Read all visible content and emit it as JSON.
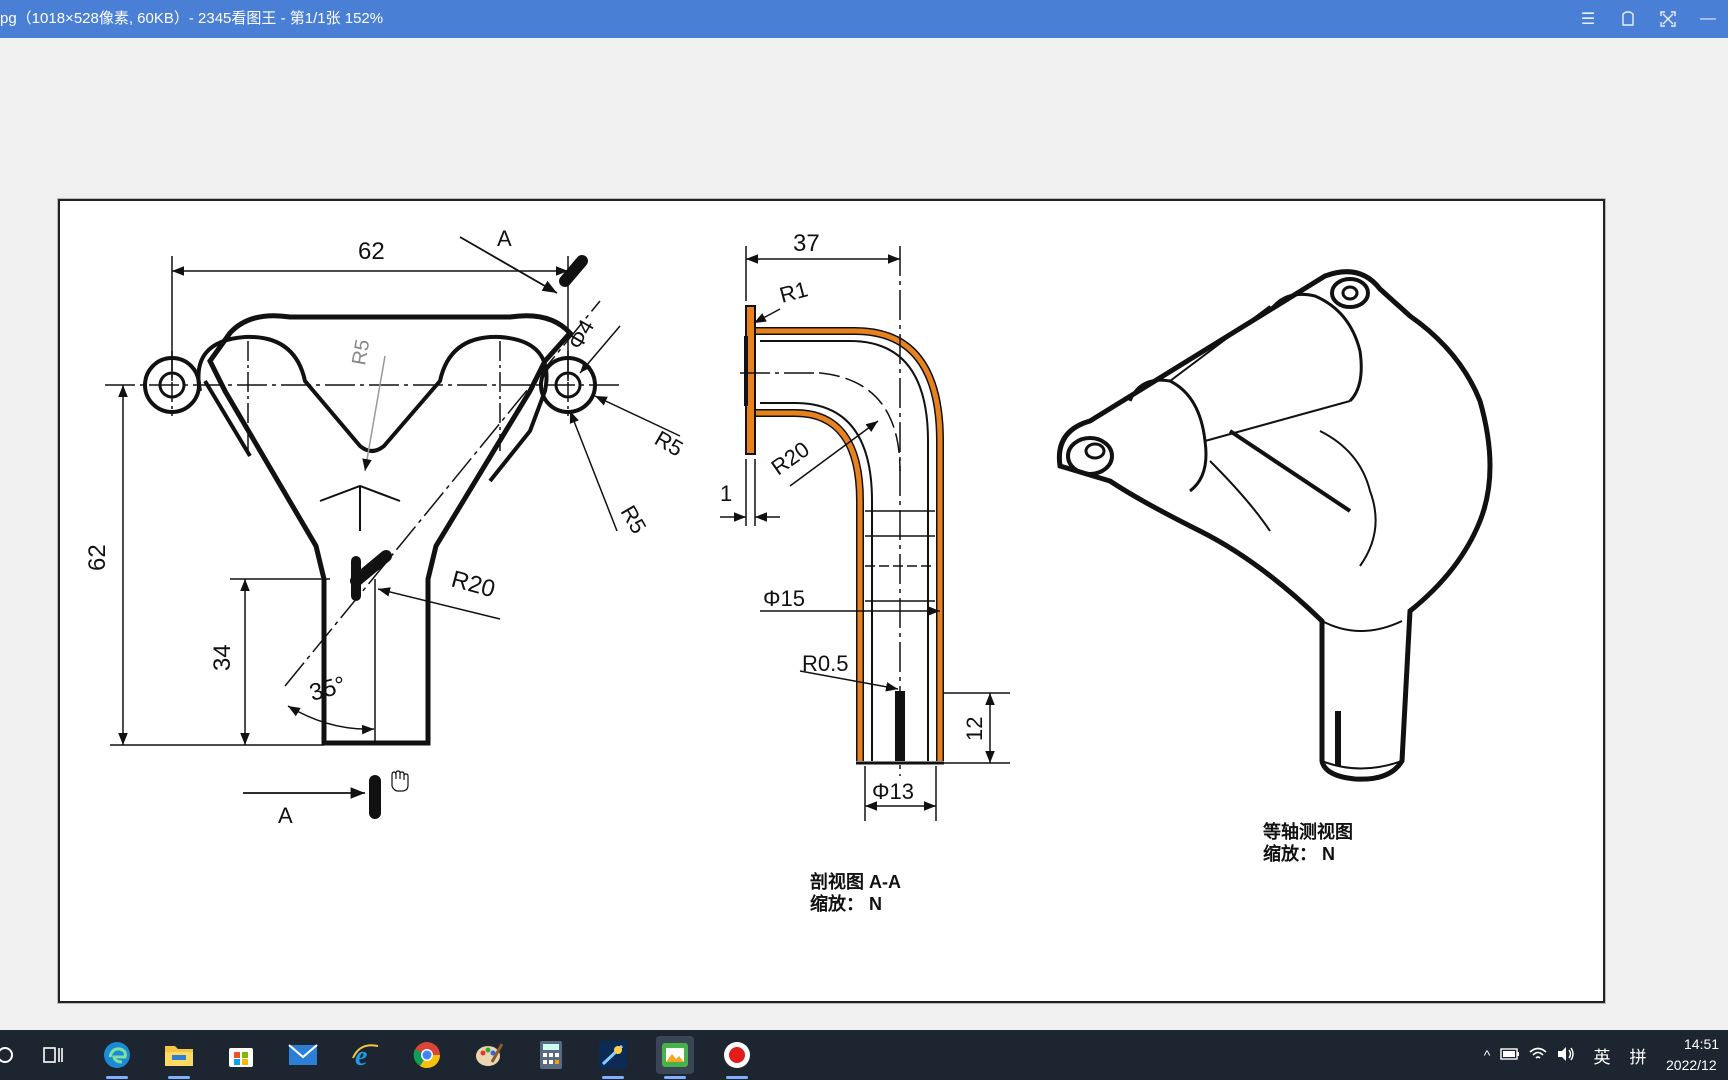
{
  "window": {
    "title": "pg（1018×528像素, 60KB）- 2345看图王 - 第1/1张 152%",
    "controls": [
      "menu-icon",
      "skin-icon",
      "fullscreen-icon",
      "minimize-icon"
    ]
  },
  "drawing": {
    "front_view": {
      "dim_top": "62",
      "dim_left": "62",
      "dim_34": "34",
      "r5_top": "R5",
      "r5_right1": "R5",
      "r5_right2": "R5",
      "phi4": "Φ4",
      "r20": "R20",
      "angle": "35°",
      "section_a_top": "A",
      "section_a_bottom": "A"
    },
    "section_view": {
      "dim_37": "37",
      "r1": "R1",
      "r20": "R20",
      "dim_1": "1",
      "phi15": "Φ15",
      "r05": "R0.5",
      "dim_12": "12",
      "phi13": "Φ13",
      "caption_line1": "剖视图  A-A",
      "caption_line2": "缩放：  N"
    },
    "iso_view": {
      "caption_line1": "等轴测视图",
      "caption_line2": "缩放：  N"
    }
  },
  "taskbar": {
    "icons": [
      "start-search-icon",
      "task-view-icon",
      "edge-icon",
      "file-explorer-icon",
      "store-icon",
      "mail-icon",
      "ie-icon",
      "chrome-icon",
      "paint-icon",
      "calculator-icon",
      "media-icon",
      "image-viewer-icon",
      "record-icon"
    ],
    "tray": {
      "ime_lang": "英",
      "ime_mode": "拼",
      "time": "14:51",
      "date": "2022/12"
    }
  },
  "colors": {
    "titlebar": "#4a7fd6",
    "taskbar": "#1d2530",
    "section_highlight": "#e8821e"
  }
}
